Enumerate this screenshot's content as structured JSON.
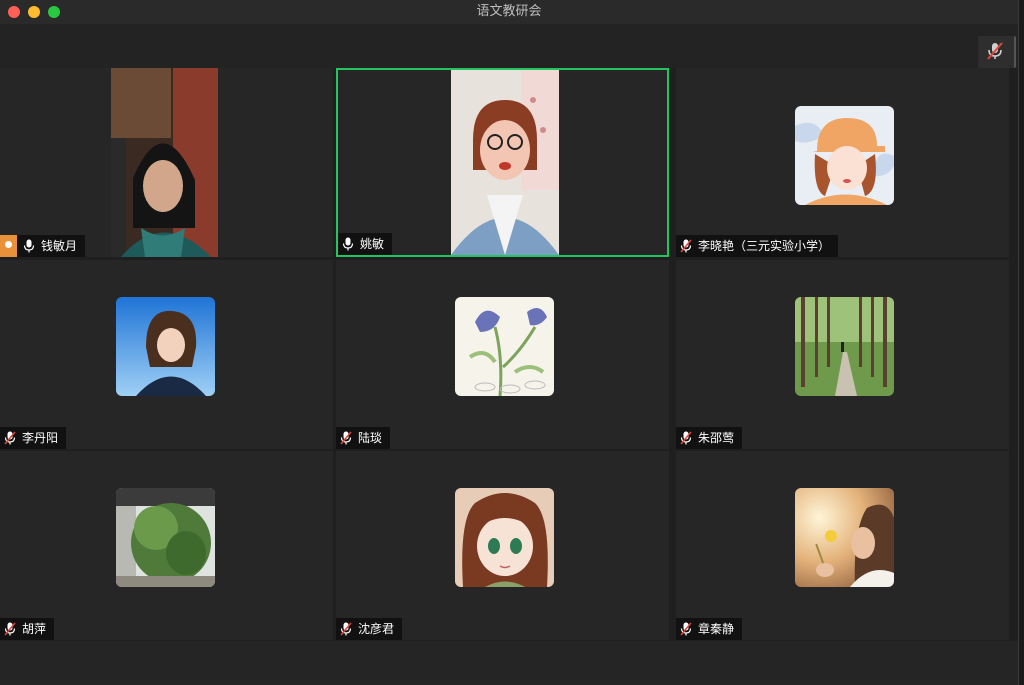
{
  "window": {
    "title": "语文教研会"
  },
  "participants": [
    {
      "name": "钱敏月",
      "muted": false,
      "host": true,
      "video": true
    },
    {
      "name": "姚敏",
      "muted": false,
      "host": false,
      "video": true,
      "speaking": true
    },
    {
      "name": "李晓艳（三元实验小学）",
      "muted": true,
      "host": false,
      "video": false
    },
    {
      "name": "李丹阳",
      "muted": true,
      "host": false,
      "video": false
    },
    {
      "name": "陆琰",
      "muted": true,
      "host": false,
      "video": false
    },
    {
      "name": "朱邵莺",
      "muted": true,
      "host": false,
      "video": false
    },
    {
      "name": "胡萍",
      "muted": true,
      "host": false,
      "video": false
    },
    {
      "name": "沈彦君",
      "muted": true,
      "host": false,
      "video": false
    },
    {
      "name": "章秦静",
      "muted": true,
      "host": false,
      "video": false
    }
  ],
  "colors": {
    "active_border": "#22c55e",
    "host_badge": "#e8913a",
    "mute_red": "#e0453a"
  }
}
